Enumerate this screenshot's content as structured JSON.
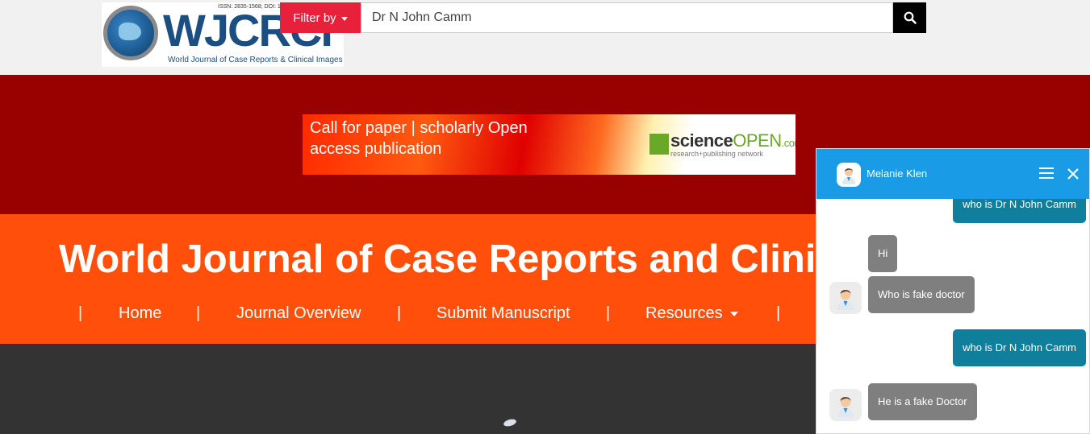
{
  "header": {
    "logo": {
      "issn": "ISSN: 2835-1568; DOI: 10",
      "mark": "WJCRCI",
      "subtitle": "World Journal of Case Reports & Clinical Images"
    },
    "filter_label": "Filter by",
    "search_value": "Dr N John Camm",
    "search_icon": "search-icon"
  },
  "ad_banner": {
    "line1": "Call for paper | scholarly Open",
    "line2": "access publication",
    "brand_science": "science",
    "brand_open": "OPEN",
    "brand_tld": ".com",
    "brand_tagline": "research+publishing network"
  },
  "journal": {
    "title": "World Journal of Case Reports and Clinical Images"
  },
  "nav": {
    "separator": "|",
    "items": [
      "Home",
      "Journal Overview",
      "Submit Manuscript",
      "Resources"
    ]
  },
  "chat": {
    "agent_name": "Melanie Klen",
    "messages": [
      {
        "from": "user",
        "text": "who is Dr N John Camm"
      },
      {
        "from": "agent",
        "text": "Hi"
      },
      {
        "from": "agent",
        "text": "Who is fake doctor"
      },
      {
        "from": "user",
        "text": "who is Dr N John Camm"
      },
      {
        "from": "agent",
        "text": "He is a fake Doctor"
      }
    ]
  },
  "colors": {
    "filter": "#e8213b",
    "banner_red": "#990000",
    "orange": "#ff4f0a",
    "dark": "#333333",
    "chat_header": "#1a9be6",
    "user_bubble": "#0f7f9c",
    "agent_bubble": "#7f7f7f"
  }
}
